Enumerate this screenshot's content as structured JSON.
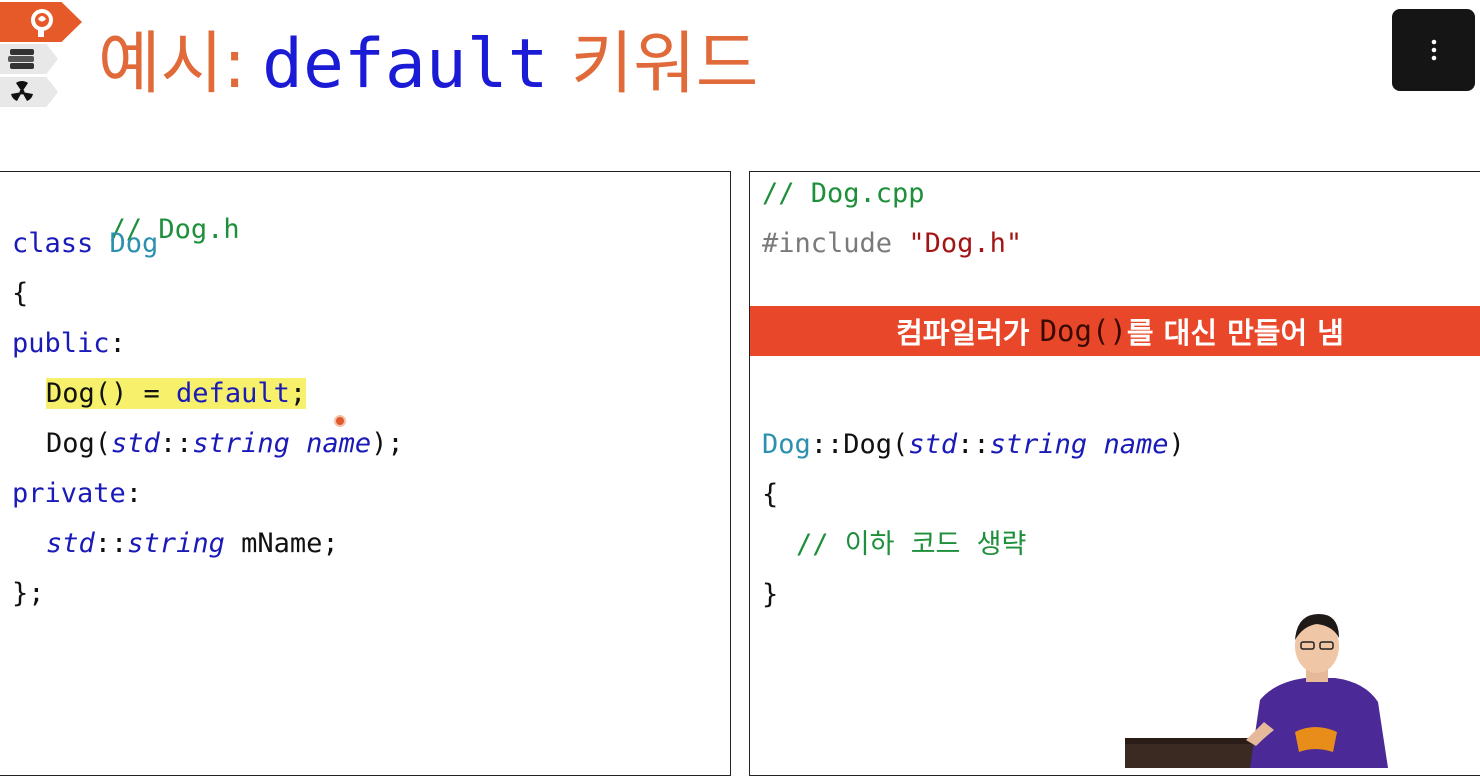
{
  "title": {
    "part1": "예시",
    "colon": ":",
    "keyword": "default",
    "part2": "키워드"
  },
  "menu_button": {
    "icon": "more-vertical-icon",
    "glyph": "⋮"
  },
  "left_panel": {
    "lines": [
      {
        "comment": "// Dog.h"
      },
      {
        "kw": "class",
        "type": "Dog"
      },
      {
        "text": "{"
      },
      {
        "kw": "public",
        "punct": ":"
      },
      {
        "pre": "Dog() = ",
        "kw": "default",
        "post": ";"
      },
      {
        "pre": "Dog(",
        "it1": "std",
        "sep": "::",
        "it2": "string",
        "it3": "name",
        "post": ");"
      },
      {
        "kw": "private",
        "punct": ":"
      },
      {
        "it1": "std",
        "sep": "::",
        "it2": "string",
        "post": " mName;"
      },
      {
        "text": "};"
      }
    ]
  },
  "right_panel": {
    "lines": [
      {
        "comment": "// Dog.cpp"
      },
      {
        "pp": "#include",
        "str": "\"Dog.h\""
      },
      {
        "type": "Dog",
        "pre": "::Dog(",
        "it1": "std",
        "sep": "::",
        "it2": "string",
        "it3": "name",
        "post": ")"
      },
      {
        "text": "{"
      },
      {
        "comment": "// 이하 코드 생략"
      },
      {
        "text": "}"
      }
    ],
    "banner": {
      "pre": "컴파일러가 ",
      "code": "Dog()",
      "post": "를 대신 만들어 냄"
    }
  },
  "colors": {
    "accent_orange": "#e06a3a",
    "banner_red": "#e8472a",
    "keyword_blue": "#1a1ab8",
    "comment_green": "#1e8f3a",
    "highlight_yellow": "#f6f06a"
  }
}
